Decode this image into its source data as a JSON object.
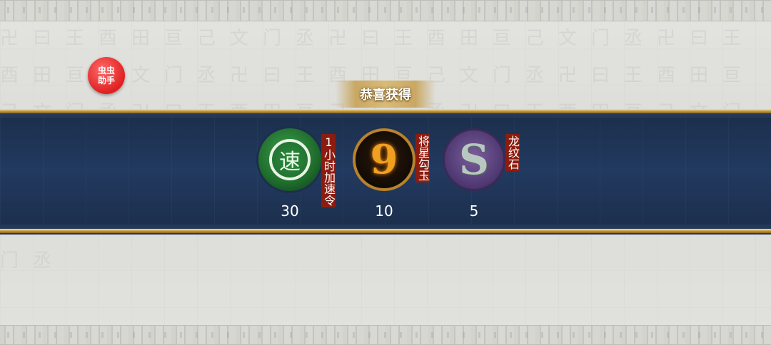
{
  "helper_button": {
    "label": "虫虫\n助手"
  },
  "dialog": {
    "title": "恭喜获得",
    "rewards": [
      {
        "name": "1小时加速令",
        "count": "30",
        "icon": "speedup-jade-icon",
        "glyph": "速"
      },
      {
        "name": "将星勾玉",
        "count": "10",
        "icon": "magatama-icon",
        "glyph": "9"
      },
      {
        "name": "龙纹石",
        "count": "5",
        "icon": "dragon-stone-icon",
        "glyph": "S"
      }
    ]
  },
  "colors": {
    "banner": "#1f3352",
    "gold": "#c49a3c",
    "tag": "#8c1c10",
    "helper": "#e02020"
  }
}
